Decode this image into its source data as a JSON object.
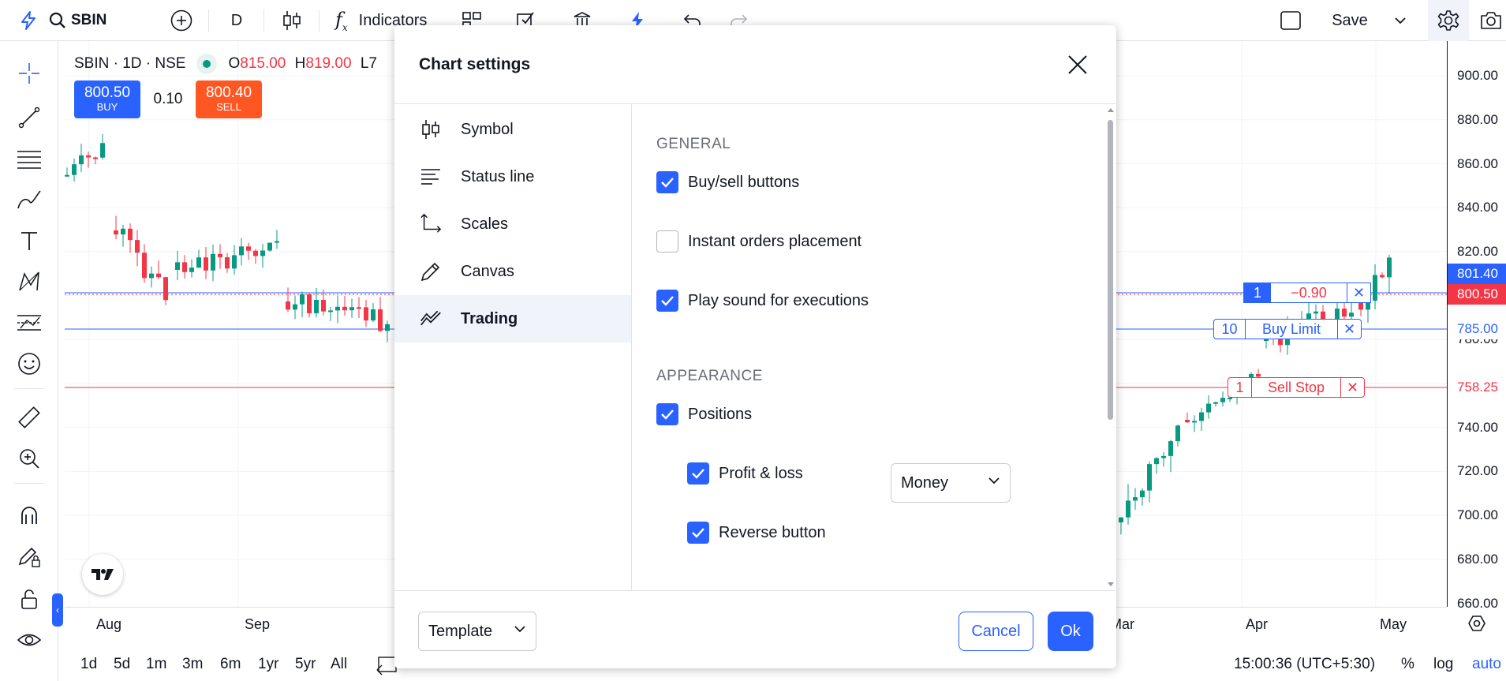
{
  "topbar": {
    "symbol": "SBIN",
    "interval": "D",
    "indicators_label": "Indicators",
    "save_label": "Save"
  },
  "legend": {
    "symbol_line": "SBIN · 1D · NSE",
    "open_label": "O",
    "open": "815.00",
    "high_label": "H",
    "high": "819.00",
    "low_label": "L7"
  },
  "buysell": {
    "buy_price": "800.50",
    "buy_label": "BUY",
    "spread": "0.10",
    "sell_price": "800.40",
    "sell_label": "SELL"
  },
  "price_axis": {
    "labels": [
      "900.00",
      "880.00",
      "860.00",
      "840.00",
      "820.00",
      "780.00",
      "740.00",
      "720.00",
      "700.00",
      "680.00",
      "660.00"
    ],
    "tags": {
      "last": "801.40",
      "bid": "800.50",
      "buy_limit": "785.00",
      "sell_stop": "758.25"
    }
  },
  "orders": {
    "position": {
      "qty": "1",
      "pnl": "−0.90",
      "close": "✕"
    },
    "buy_limit": {
      "qty": "10",
      "label": "Buy Limit",
      "close": "✕"
    },
    "sell_stop": {
      "qty": "1",
      "label": "Sell Stop",
      "close": "✕"
    }
  },
  "time_axis": [
    "Aug",
    "Sep",
    "Mar",
    "Apr",
    "May"
  ],
  "bottombar": {
    "ranges": [
      "1d",
      "5d",
      "1m",
      "3m",
      "6m",
      "1yr",
      "5yr",
      "All"
    ],
    "clock": "15:00:36 (UTC+5:30)",
    "percent": "%",
    "log": "log",
    "auto": "auto"
  },
  "modal": {
    "title": "Chart settings",
    "nav": [
      {
        "label": "Symbol",
        "icon": "candles-icon"
      },
      {
        "label": "Status line",
        "icon": "status-line-icon"
      },
      {
        "label": "Scales",
        "icon": "scales-icon"
      },
      {
        "label": "Canvas",
        "icon": "pencil-icon"
      },
      {
        "label": "Trading",
        "icon": "trading-icon",
        "active": true
      }
    ],
    "general_title": "GENERAL",
    "appearance_title": "APPEARANCE",
    "options": {
      "buysell": {
        "label": "Buy/sell buttons",
        "checked": true
      },
      "instant": {
        "label": "Instant orders placement",
        "checked": false
      },
      "sound": {
        "label": "Play sound for executions",
        "checked": true
      },
      "positions": {
        "label": "Positions",
        "checked": true
      },
      "pnl": {
        "label": "Profit & loss",
        "checked": true
      },
      "reverse": {
        "label": "Reverse button",
        "checked": true
      }
    },
    "pnl_select": "Money",
    "template_label": "Template",
    "cancel_label": "Cancel",
    "ok_label": "Ok"
  },
  "colors": {
    "accent": "#2962ff",
    "up": "#089981",
    "down": "#f23645",
    "sell_button": "#ff5722"
  }
}
